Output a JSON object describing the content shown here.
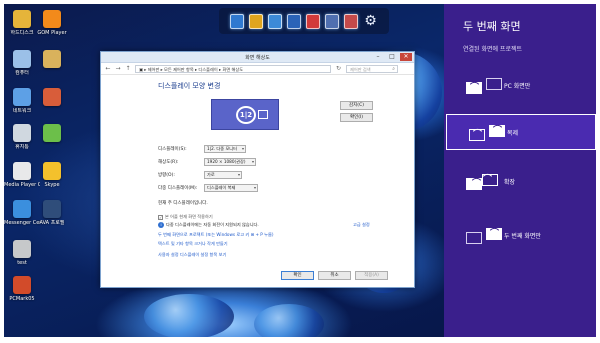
{
  "desktop": {
    "icons": [
      {
        "label": "하드디스크",
        "color": "#e5b43a"
      },
      {
        "label": "GOM Player",
        "color": "#f28a1b"
      },
      {
        "label": "컴퓨터",
        "color": "#9bc0e8"
      },
      {
        "label": "",
        "color": "#d9b25c"
      },
      {
        "label": "네트워크",
        "color": "#5da0e6"
      },
      {
        "label": "",
        "color": "#d85d3a"
      },
      {
        "label": "휴지통",
        "color": "#d0d8e0"
      },
      {
        "label": "",
        "color": "#6cbf4a"
      },
      {
        "label": "Media Player Center",
        "color": "#e8e9ea"
      },
      {
        "label": "Skype",
        "color": "#f4c12c"
      },
      {
        "label": "Messenger Center",
        "color": "#3b8fde"
      },
      {
        "label": "AVA 프로필",
        "color": "#2f4d7a"
      },
      {
        "label": "test",
        "color": "#c6c8ca"
      },
      {
        "label": "PCMark05",
        "color": "#d24b2a"
      }
    ],
    "dock": {
      "items": [
        {
          "name": "dock-doc-icon",
          "color": "#2f79d0"
        },
        {
          "name": "dock-gold-icon",
          "color": "#e0a51e"
        },
        {
          "name": "dock-globe-icon",
          "color": "#3c8ad8"
        },
        {
          "name": "dock-media-icon",
          "color": "#2a63b8"
        },
        {
          "name": "dock-red-icon",
          "color": "#d23a3a"
        },
        {
          "name": "dock-tv-icon",
          "color": "#4f6fb0"
        },
        {
          "name": "dock-edit-icon",
          "color": "#c44a4a"
        }
      ],
      "gear_glyph": "⚙"
    }
  },
  "window": {
    "title": "화면 해상도",
    "controls": {
      "minimize": "–",
      "maximize": "□",
      "close": "✕"
    },
    "address": "▣ ▸ 제어판 ▸ 모든 제어판 항목 ▸ 디스플레이 ▸ 화면 해상도",
    "search_placeholder": "제어판 검색",
    "heading": "디스플레이 모양 변경",
    "monitor_badge": "1|2",
    "detect_button": "감지(C)",
    "identify_button": "확인(I)",
    "rows": [
      {
        "label": "디스플레이(S):",
        "value": "1|2. 다중 모니터"
      },
      {
        "label": "해상도(R):",
        "value": "1920 × 1080(권장)"
      },
      {
        "label": "방향(O):",
        "value": "가로"
      },
      {
        "label": "다중 디스플레이(M):",
        "value": "디스플레이 복제"
      }
    ],
    "primary_text": "현재 주 디스플레이입니다.",
    "checkbox_label": "본 어플 현재 화면 적용하기",
    "advanced_link": "고급 설정",
    "info_text": "다중 디스플레이에는 자동 회전이 지원되지 않습니다.",
    "link1": "두 번째 화면으로 프로젝트 (또는 Windows 로고 키 ⊞ + P 누름)",
    "link2": "텍스트 및 기타 항목 크거나 작게 만들기",
    "link3": "사용자 설정 디스플레이 설정 항목 보기",
    "buttons": {
      "ok": "확인",
      "cancel": "취소",
      "apply": "적용(A)"
    }
  },
  "panel": {
    "title": "두 번째 화면",
    "subtitle": "연결된 화면에 프로젝트",
    "options": [
      {
        "label": "PC 화면만",
        "active": false
      },
      {
        "label": "복제",
        "active": true
      },
      {
        "label": "확장",
        "active": false
      },
      {
        "label": "두 번째 화면만",
        "active": false
      }
    ],
    "colors": {
      "background": "#3a1f8c",
      "active": "#4a2bb0"
    }
  }
}
